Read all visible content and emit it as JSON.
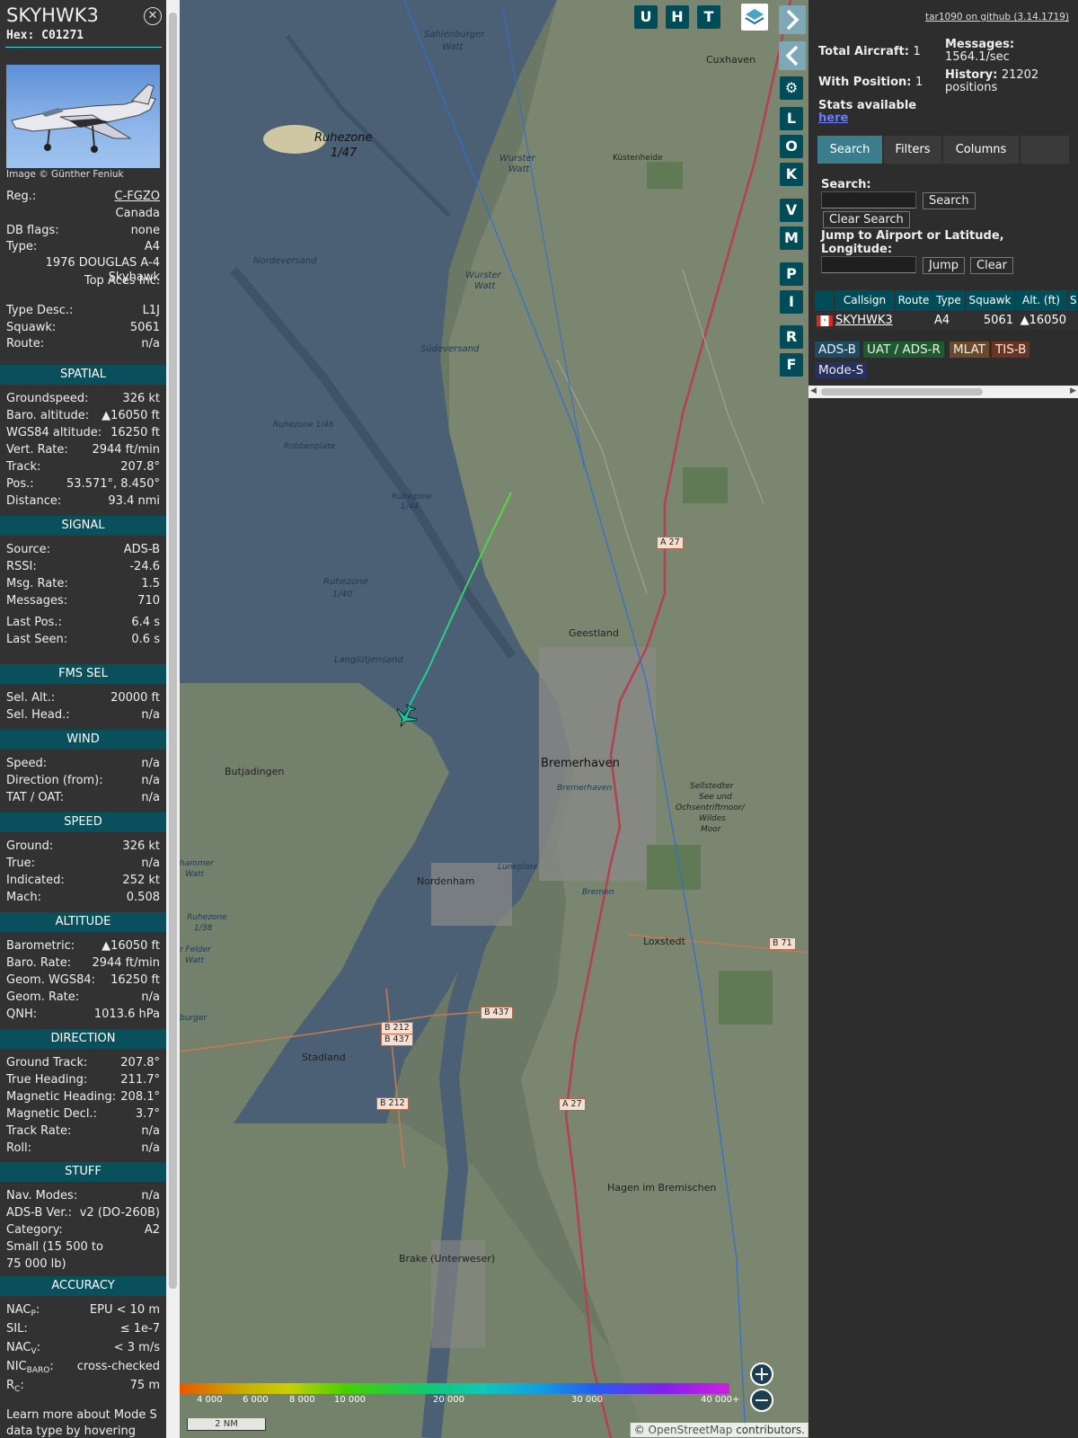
{
  "aircraft": {
    "callsign": "SKYHWK3",
    "hex": "Hex: C01271",
    "photo_credit": "Image © Günther Feniuk",
    "general": [
      {
        "k": "Reg.:",
        "v": "C-FGZO"
      },
      {
        "k": "",
        "v": "Canada"
      },
      {
        "k": "DB flags:",
        "v": "none"
      },
      {
        "k": "Type:",
        "v": "A4"
      },
      {
        "k": "",
        "v": "1976 DOUGLAS A-4 Skyhawk"
      },
      {
        "k": "",
        "v": "Top Aces Inc."
      },
      {
        "k": "Type Desc.:",
        "v": "L1J"
      },
      {
        "k": "Squawk:",
        "v": "5061"
      },
      {
        "k": "Route:",
        "v": "n/a"
      }
    ],
    "sections": [
      {
        "title": "SPATIAL",
        "rows": [
          {
            "k": "Groundspeed:",
            "v": "326 kt"
          },
          {
            "k": "Baro. altitude:",
            "v": "▲16050 ft"
          },
          {
            "k": "WGS84 altitude:",
            "v": "16250 ft"
          },
          {
            "k": "Vert. Rate:",
            "v": "2944 ft/min"
          },
          {
            "k": "Track:",
            "v": "207.8°"
          },
          {
            "k": "Pos.:",
            "v": "53.571°, 8.450°"
          },
          {
            "k": "Distance:",
            "v": "93.4 nmi"
          }
        ]
      },
      {
        "title": "SIGNAL",
        "rows": [
          {
            "k": "Source:",
            "v": "ADS-B"
          },
          {
            "k": "RSSI:",
            "v": "-24.6"
          },
          {
            "k": "Msg. Rate:",
            "v": "1.5"
          },
          {
            "k": "Messages:",
            "v": "710"
          },
          {
            "k": "Last Pos.:",
            "v": "6.4 s"
          },
          {
            "k": "Last Seen:",
            "v": "0.6 s"
          }
        ]
      },
      {
        "title": "FMS SEL",
        "rows": [
          {
            "k": "Sel. Alt.:",
            "v": "20000 ft"
          },
          {
            "k": "Sel. Head.:",
            "v": "n/a"
          }
        ]
      },
      {
        "title": "WIND",
        "rows": [
          {
            "k": "Speed:",
            "v": "n/a"
          },
          {
            "k": "Direction (from):",
            "v": "n/a"
          },
          {
            "k": "TAT / OAT:",
            "v": "n/a"
          }
        ]
      },
      {
        "title": "SPEED",
        "rows": [
          {
            "k": "Ground:",
            "v": "326 kt"
          },
          {
            "k": "True:",
            "v": "n/a"
          },
          {
            "k": "Indicated:",
            "v": "252 kt"
          },
          {
            "k": "Mach:",
            "v": "0.508"
          }
        ]
      },
      {
        "title": "ALTITUDE",
        "rows": [
          {
            "k": "Barometric:",
            "v": "▲16050 ft"
          },
          {
            "k": "Baro. Rate:",
            "v": "2944 ft/min"
          },
          {
            "k": "Geom. WGS84:",
            "v": "16250 ft"
          },
          {
            "k": "Geom. Rate:",
            "v": "n/a"
          },
          {
            "k": "QNH:",
            "v": "1013.6 hPa"
          }
        ]
      },
      {
        "title": "DIRECTION",
        "rows": [
          {
            "k": "Ground Track:",
            "v": "207.8°"
          },
          {
            "k": "True Heading:",
            "v": "211.7°"
          },
          {
            "k": "Magnetic Heading:",
            "v": "208.1°"
          },
          {
            "k": "Magnetic Decl.:",
            "v": "3.7°"
          },
          {
            "k": "Track Rate:",
            "v": "n/a"
          },
          {
            "k": "Roll:",
            "v": "n/a"
          }
        ]
      },
      {
        "title": "STUFF",
        "rows": [
          {
            "k": "Nav. Modes:",
            "v": "n/a"
          },
          {
            "k": "ADS-B Ver.:",
            "v": "v2 (DO-260B)"
          },
          {
            "k": "Category:",
            "v": "A2"
          },
          {
            "k": "Small (15 500 to",
            "v": ""
          },
          {
            "k": "75 000 lb)",
            "v": ""
          }
        ]
      },
      {
        "title": "ACCURACY",
        "rows": [
          {
            "k": "NAC",
            "sub": "P",
            "v": "EPU < 10 m"
          },
          {
            "k": "SIL:",
            "v": "≤ 1e-7"
          },
          {
            "k": "NAC",
            "sub": "V",
            "v": "< 3 m/s"
          },
          {
            "k": "NIC",
            "sub": "BARO",
            "v": "cross-checked"
          },
          {
            "k": "R",
            "sub": "C",
            "v": "75 m"
          }
        ]
      }
    ],
    "footer_note_1": "Learn more about Mode S",
    "footer_note_2": "data type by hovering over"
  },
  "map": {
    "top_buttons": [
      "U",
      "H",
      "T"
    ],
    "side_buttons": [
      "L",
      "O",
      "K",
      "V",
      "M",
      "P",
      "I",
      "R",
      "F"
    ],
    "labels": {
      "cuxhaven": "Cuxhaven",
      "sahlenburger_1": "Sahlenburger",
      "sahlenburger_2": "Watt",
      "ruhezone_147_1": "Ruhezone",
      "ruhezone_147_2": "1/47",
      "nordeversand": "Nordeversand",
      "wurster_1": "Wurster",
      "wurster_2": "Watt",
      "kustenheide": "Küstenheide",
      "wurster2_1": "Wurster",
      "wurster2_2": "Watt",
      "sudeversand": "Südeversand",
      "ruhezone_146": "Ruhezone 1/46",
      "robbenplate": "Robbenplate",
      "ruhezone_144_1": "Ruhezone",
      "ruhezone_144_2": "1/44",
      "ruhezone_140_1": "Ruhezone",
      "ruhezone_140_2": "1/40",
      "langlutjensand": "Langlütjensand",
      "geestland": "Geestland",
      "butjadingen": "Butjadingen",
      "bremerhaven": "Bremerhaven",
      "bremerhaven_small": "Bremerhaven",
      "sellstedter_1": "Sellstedter",
      "sellstedter_2": "See und",
      "sellstedter_3": "Ochsentriftmoor/",
      "sellstedter_4": "Wildes",
      "sellstedter_5": "Moor",
      "nordenham": "Nordenham",
      "luneplate": "Luneplate",
      "bremen": "Bremen",
      "loxstedt": "Loxstedt",
      "stadland": "Stadland",
      "hagen": "Hagen im Bremischen",
      "brake": "Brake (Unterweser)",
      "ruhezone_138_1": "Ruhezone",
      "ruhezone_138_2": "1/38",
      "hammer_1": "hammer",
      "hammer_2": "Watt",
      "burger": "burger",
      "felder_1": "r Felder",
      "felder_2": "Watt"
    },
    "shields": {
      "a27_top": "A 27",
      "a27_bottom": "A 27",
      "b71": "B 71",
      "b437": "B 437",
      "b212_1": "B 212",
      "b212_2": "B 437",
      "b212_3": "B 212"
    },
    "alt_scale_ticks": [
      "4 000",
      "6 000",
      "8 000",
      "10 000",
      "20 000",
      "30 000",
      "40 000+"
    ],
    "scale_bar": "2 NM",
    "zoom_in": "+",
    "zoom_out": "−",
    "attribution_prefix": "© ",
    "attribution_link": "OpenStreetMap",
    "attribution_suffix": " contributors."
  },
  "panel": {
    "github_link": "tar1090 on github (3.14.1719)",
    "total_aircraft_label": "Total Aircraft:",
    "total_aircraft_value": "1",
    "with_position_label": "With Position:",
    "with_position_value": "1",
    "messages_label": "Messages:",
    "messages_value": "1564.1/sec",
    "history_label": "History:",
    "history_value": "21202",
    "history_unit": "positions",
    "stats_text": "Stats available",
    "stats_link": "here",
    "tabs": [
      "Search",
      "Filters",
      "Columns"
    ],
    "search_label": "Search:",
    "search_button": "Search",
    "clear_search_button": "Clear Search",
    "jump_label_1": "Jump to Airport or Latitude,",
    "jump_label_2": "Longitude:",
    "jump_button": "Jump",
    "clear_button": "Clear",
    "table_headers": [
      "Callsign",
      "Route",
      "Type",
      "Squawk",
      "Alt. (ft)",
      "Sp"
    ],
    "table_rows": [
      {
        "callsign": "SKYHWK3",
        "route": "",
        "type": "A4",
        "squawk": "5061",
        "alt": "▲16050"
      }
    ],
    "sources": [
      "ADS-B",
      "UAT / ADS-R",
      "MLAT",
      "TIS-B",
      "Mode-S"
    ],
    "source_colors": [
      "#1f4a63",
      "#1f5a2e",
      "#6b4a2a",
      "#6b3420",
      "#27305e"
    ]
  }
}
